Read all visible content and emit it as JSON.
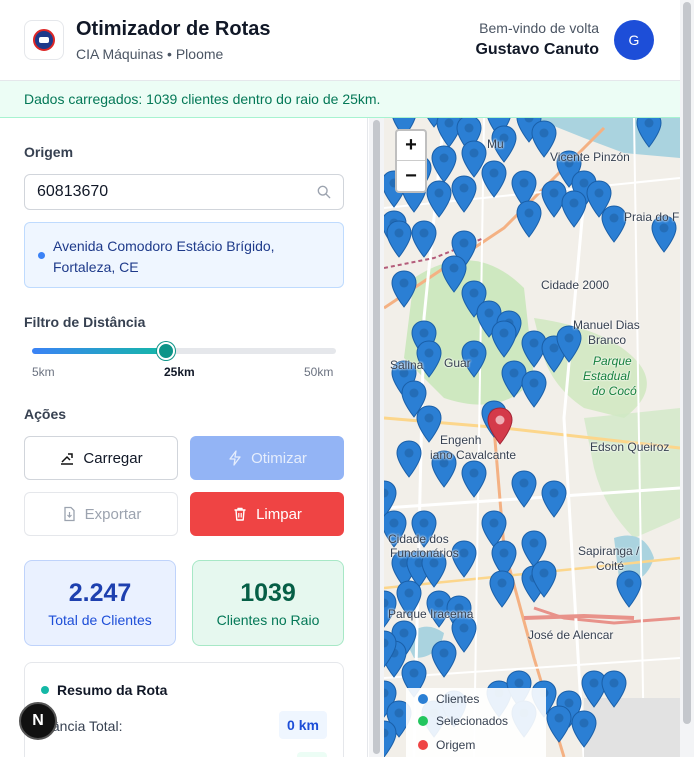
{
  "header": {
    "title": "Otimizador de Rotas",
    "subtitle": "CIA Máquinas • Ploome",
    "welcome": "Bem-vindo de volta",
    "user_name": "Gustavo Canuto",
    "avatar_initial": "G"
  },
  "banner": {
    "message": "Dados carregados: 1039 clientes dentro do raio de 25km."
  },
  "sidebar": {
    "origin_label": "Origem",
    "origin_value": "60813670",
    "address": "Avenida Comodoro Estácio Brígido, Fortaleza, CE",
    "distance_label": "Filtro de Distância",
    "slider": {
      "min_label": "5km",
      "value_label": "25km",
      "max_label": "50km",
      "value_fraction": 0.44
    },
    "actions_label": "Ações",
    "buttons": {
      "load": "Carregar",
      "optimize": "Otimizar",
      "export": "Exportar",
      "clear": "Limpar"
    },
    "stats": {
      "total_value": "2.247",
      "total_label": "Total de Clientes",
      "radius_value": "1039",
      "radius_label": "Clientes no Raio"
    },
    "summary": {
      "title": "Resumo da Rota",
      "distance_label": "stância Total:",
      "distance_value": "0 km"
    }
  },
  "badge": {
    "letter": "N"
  },
  "map": {
    "zoom_in": "+",
    "zoom_out": "−",
    "labels": {
      "vicente": "Vicente Pinzón",
      "praia": "Praia do F",
      "cidade2000": "Cidade 2000",
      "manuel1": "Manuel Dias",
      "manuel2": "Branco",
      "parque1": "Parque",
      "parque2": "Estadual",
      "parque3": "do Cocó",
      "salina": "Salina",
      "guar": "Guar",
      "edson": "Edson Queiroz",
      "engenh": "Engenh",
      "cavalcante": "iano Cavalcante",
      "cidadedos": "Cidade dos",
      "funcionarios": "Funcionários",
      "sapiranga1": "Sapiranga /",
      "sapiranga2": "Coité",
      "parque_iracema": "Parque Iracema",
      "jose": "José de Alencar",
      "mu": "Mu"
    },
    "legend": {
      "clientes": "Clientes",
      "selecionados": "Selecionados",
      "origem": "Origem"
    },
    "colors": {
      "client_pin": "#2b7fd4",
      "origin_pin": "#d43a4a",
      "selected": "#22c55e"
    }
  }
}
